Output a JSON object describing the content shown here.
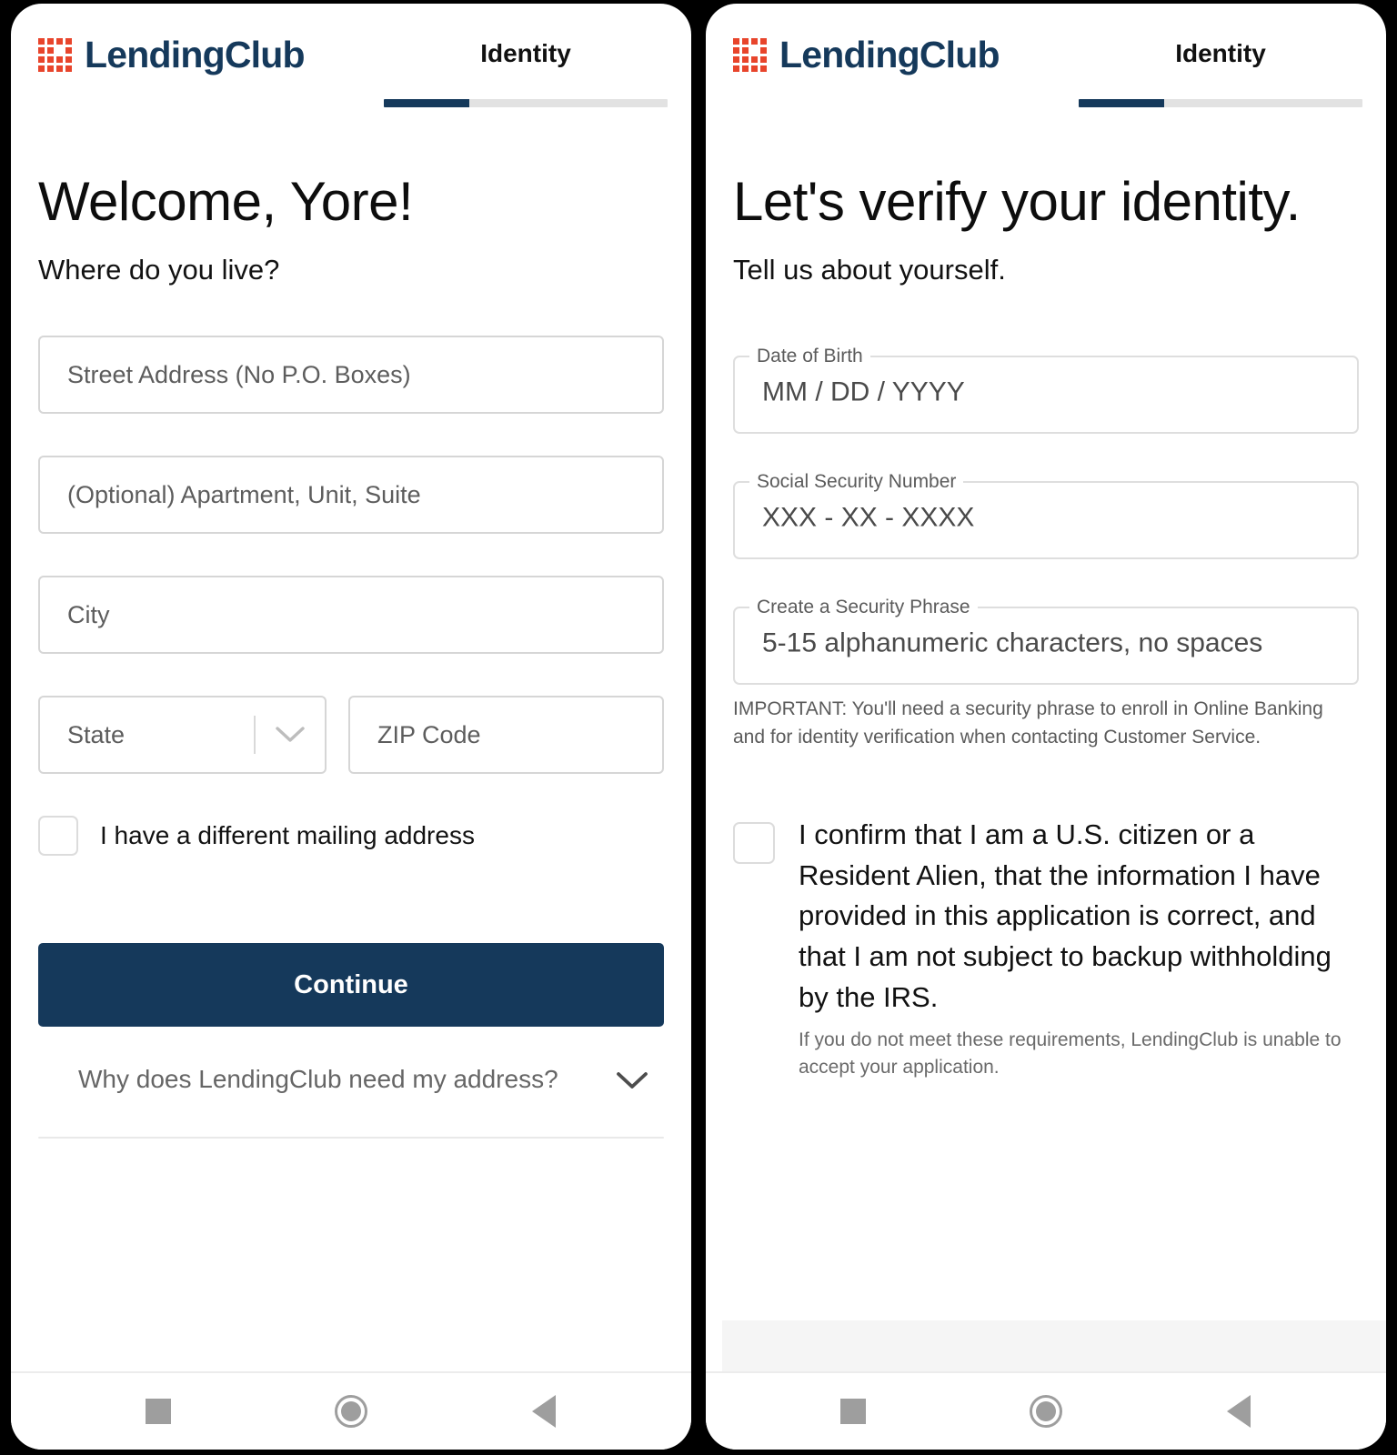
{
  "brand": {
    "name": "LendingClub",
    "logo_icon": "lendingclub-grid-logo",
    "logo_color": "#e8452c",
    "text_color": "#15395b"
  },
  "theme": {
    "primary": "#15395b",
    "accent": "#e8452c",
    "border": "#d6d6d6",
    "muted_text": "#5d5d5d",
    "band": "#f5f5f5"
  },
  "navbar": {
    "recents_label": "recents-square-icon",
    "home_label": "home-circle-icon",
    "back_label": "back-triangle-icon"
  },
  "left_screen": {
    "header": {
      "step_title": "Identity",
      "progress_percent": 30
    },
    "title": "Welcome, Yore!",
    "subtitle": "Where do you live?",
    "fields": [
      {
        "name": "street-address",
        "placeholder": "Street Address (No P.O. Boxes)",
        "value": ""
      },
      {
        "name": "apartment",
        "placeholder": "(Optional) Apartment, Unit, Suite",
        "value": ""
      },
      {
        "name": "city",
        "placeholder": "City",
        "value": ""
      }
    ],
    "state_field": {
      "placeholder": "State",
      "value": "",
      "chevron_icon": "chevron-down-icon"
    },
    "zip_field": {
      "placeholder": "ZIP Code",
      "value": ""
    },
    "mailing_checkbox": {
      "label": "I have a different mailing address",
      "checked": false
    },
    "continue_button": "Continue",
    "accordion": {
      "label": "Why does LendingClub need my address?",
      "chevron_icon": "chevron-down-icon",
      "expanded": false
    }
  },
  "right_screen": {
    "header": {
      "step_title": "Identity",
      "progress_percent": 30
    },
    "title": "Let's verify your identity.",
    "subtitle": "Tell us about yourself.",
    "fields": [
      {
        "name": "date-of-birth",
        "label": "Date of Birth",
        "value": "MM / DD / YYYY"
      },
      {
        "name": "social-security-number",
        "label": "Social Security Number",
        "value": "XXX - XX - XXXX"
      },
      {
        "name": "security-phrase",
        "label": "Create a Security Phrase",
        "value": "5-15 alphanumeric characters, no spaces"
      }
    ],
    "security_phrase_helper": "IMPORTANT: You'll need a security phrase to enroll in Online Banking and for identity verification when contacting Customer Service.",
    "confirm_checkbox": {
      "checked": false,
      "label": "I confirm that I am a U.S. citizen or a Resident Alien, that the information I have provided in this application is correct, and that I am not subject to backup withholding by the IRS.",
      "note": "If you do not meet these requirements, LendingClub is unable to accept your application."
    }
  }
}
